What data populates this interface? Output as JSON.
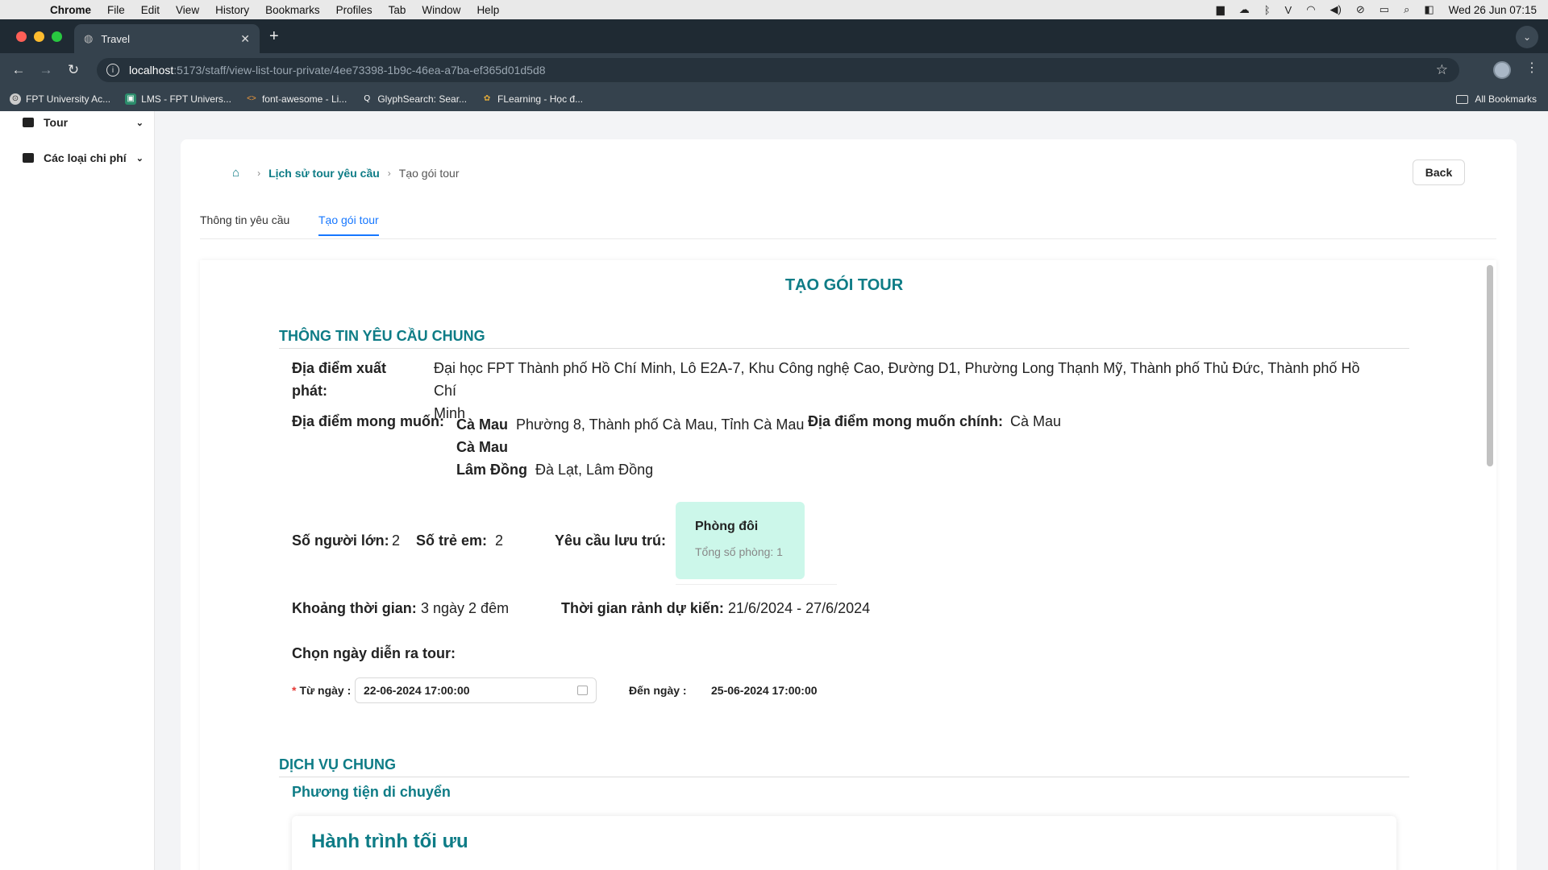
{
  "menubar": {
    "app": "Chrome",
    "menus": [
      "File",
      "Edit",
      "View",
      "History",
      "Bookmarks",
      "Profiles",
      "Tab",
      "Window",
      "Help"
    ],
    "clock": "Wed 26 Jun  07:15"
  },
  "browser": {
    "tab_title": "Travel",
    "url_host": "localhost",
    "url_path": ":5173/staff/view-list-tour-private/4ee73398-1b9c-46ea-a7ba-ef365d01d5d8",
    "bookmarks": [
      "FPT University Ac...",
      "LMS - FPT Univers...",
      "font-awesome - Li...",
      "GlyphSearch: Sear...",
      "FLearning - Học đ..."
    ],
    "all_bookmarks": "All Bookmarks"
  },
  "sidebar": {
    "items": [
      {
        "label": "Tour"
      },
      {
        "label": "Các loại chi phí"
      }
    ]
  },
  "breadcrumb": {
    "link": "Lịch sử tour yêu cầu",
    "current": "Tạo gói tour"
  },
  "back_label": "Back",
  "tabs": [
    "Thông tin yêu cầu",
    "Tạo gói tour"
  ],
  "page": {
    "title": "TẠO GÓI TOUR",
    "section_general": "THÔNG TIN YÊU CẦU CHUNG",
    "departure_label_1": "Địa điểm xuất",
    "departure_label_2": "phát:",
    "departure_value_1": "Đại học FPT Thành phố Hồ Chí Minh, Lô E2A-7, Khu Công nghệ Cao, Đường D1, Phường Long Thạnh Mỹ, Thành phố Thủ Đức, Thành phố Hồ Chí",
    "departure_value_2": "Minh",
    "desired_label": "Địa điểm mong muốn:",
    "desired_1_name": "Cà Mau",
    "desired_1_detail": "Phường 8, Thành phố Cà Mau, Tỉnh Cà Mau",
    "desired_2_name": "Cà Mau",
    "desired_3_name": "Lâm Đồng",
    "desired_3_detail": "Đà Lạt, Lâm Đồng",
    "main_desired_label": "Địa điểm mong muốn chính:",
    "main_desired_value": "Cà Mau",
    "adults_label": "Số người lớn:",
    "adults_value": "2",
    "children_label": "Số trẻ em:",
    "children_value": "2",
    "stay_label": "Yêu cầu lưu trú:",
    "room_name": "Phòng đôi",
    "room_total": "Tổng số phòng: 1",
    "duration_label": "Khoảng thời gian:",
    "duration_value": "3 ngày 2 đêm",
    "free_time_label": "Thời gian rảnh dự kiến:",
    "free_time_value": "21/6/2024 - 27/6/2024",
    "choose_date_label": "Chọn ngày diễn ra tour:",
    "from_label": "Từ ngày",
    "from_value": "22-06-2024 17:00:00",
    "to_label": "Đến ngày",
    "to_value": "25-06-2024 17:00:00",
    "section_services": "DỊCH VỤ CHUNG",
    "transport_label": "Phương tiện di chuyển",
    "optimal_route": "Hành trình tối ưu"
  }
}
